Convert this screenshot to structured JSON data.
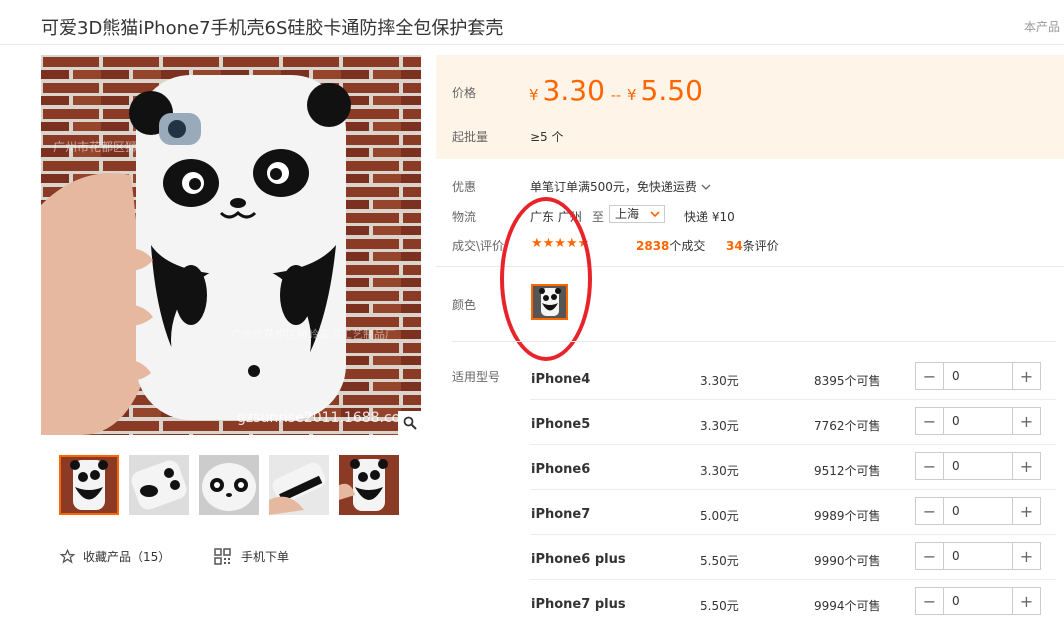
{
  "product_title": "可爱3D熊猫iPhone7手机壳6S硅胶卡通防摔全包保护套壳",
  "top_right_text": "本产品",
  "watermark_top": "广州市花都区狮",
  "watermark_mid": "广州市花都区狮岭鑫源工艺制品厂",
  "watermark_url": "gzsunrise2011.1688.com",
  "price": {
    "label": "价格",
    "currency": "¥",
    "low": "3.30",
    "separator": "--",
    "high": "5.50"
  },
  "moq": {
    "label": "起批量",
    "value": "≥5 个"
  },
  "promo": {
    "label": "优惠",
    "value": "单笔订单满500元，免快递运费"
  },
  "logistics": {
    "label": "物流",
    "from": "广东 广州",
    "to_word": "至",
    "destination": "上海",
    "shipping": "快递 ¥10"
  },
  "trade": {
    "label": "成交\\评价",
    "stars": "★★★★★",
    "rating": 5,
    "deals_count": "2838",
    "deals_suffix": "个成交",
    "reviews_count": "34",
    "reviews_suffix": "条评价"
  },
  "color_label": "颜色",
  "model_label": "适用型号",
  "models": [
    {
      "name": "iPhone4",
      "price": "3.30元",
      "stock": "8395个可售",
      "qty": "0"
    },
    {
      "name": "iPhone5",
      "price": "3.30元",
      "stock": "7762个可售",
      "qty": "0"
    },
    {
      "name": "iPhone6",
      "price": "3.30元",
      "stock": "9512个可售",
      "qty": "0"
    },
    {
      "name": "iPhone7",
      "price": "5.00元",
      "stock": "9989个可售",
      "qty": "0"
    },
    {
      "name": "iPhone6 plus",
      "price": "5.50元",
      "stock": "9990个可售",
      "qty": "0"
    },
    {
      "name": "iPhone7 plus",
      "price": "5.50元",
      "stock": "9994个可售",
      "qty": "0"
    }
  ],
  "favorite": {
    "label": "收藏产品（15）"
  },
  "mobile_order": {
    "label": "手机下单"
  },
  "colors": {
    "accent": "#ff6600",
    "price_bg": "#fff4e8",
    "annotation": "#e8232a"
  }
}
